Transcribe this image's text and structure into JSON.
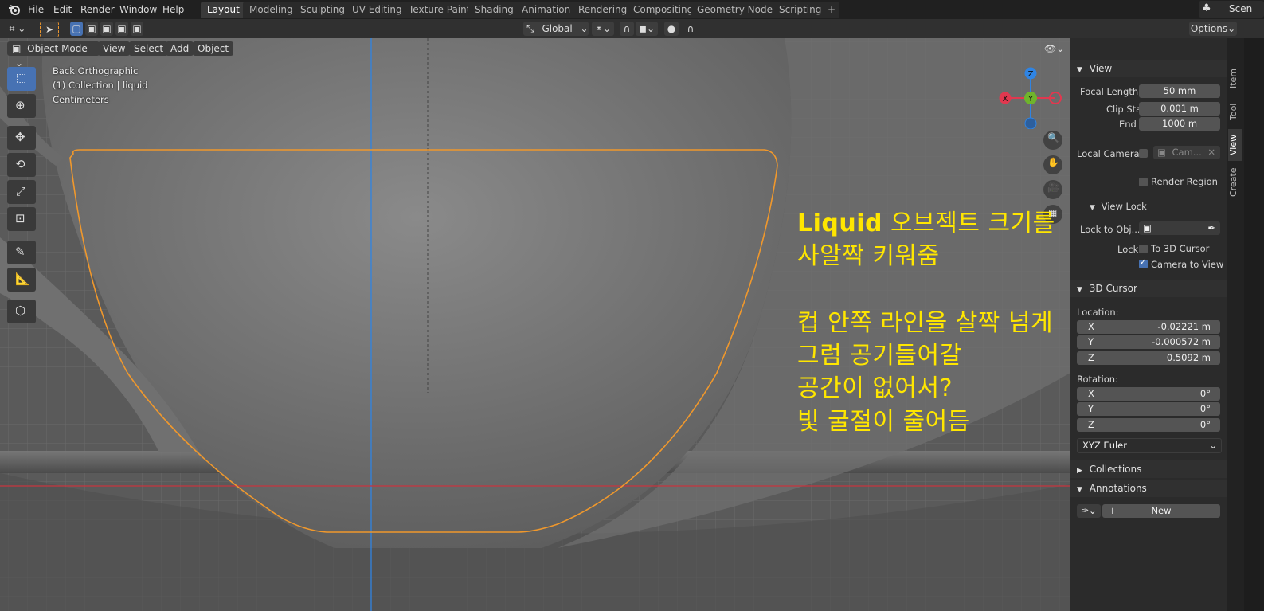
{
  "topbar": {
    "menus": [
      "File",
      "Edit",
      "Render",
      "Window",
      "Help"
    ],
    "workspaces": [
      "Layout",
      "Modeling",
      "Sculpting",
      "UV Editing",
      "Texture Paint",
      "Shading",
      "Animation",
      "Rendering",
      "Compositing",
      "Geometry Nodes",
      "Scripting"
    ],
    "active_workspace": "Layout",
    "add_tab": "+",
    "scene_label": "Scen"
  },
  "toolheader": {
    "orientation": "Global",
    "options": "Options"
  },
  "viewport_header": {
    "mode": "Object Mode",
    "menus": [
      "View",
      "Select",
      "Add",
      "Object"
    ]
  },
  "viewport_info": {
    "view": "Back Orthographic",
    "collection": "(1) Collection | liquid",
    "units": "Centimeters"
  },
  "gizmo": {
    "z": "Z",
    "y": "Y",
    "x": "X"
  },
  "annotation_note": {
    "line1_bold": "Liquid",
    "line1_rest": " 오브젝트 크기를",
    "line2": "사알짝 키워줌",
    "line3": "컵 안쪽 라인을 살짝 넘게",
    "line4": "그럼 공기들어갈",
    "line5": "공간이 없어서?",
    "line6": "빛 굴절이 줄어듬"
  },
  "sidebar": {
    "view_panel": {
      "title": "View",
      "focal_length_label": "Focal Length",
      "focal_length": "50 mm",
      "clip_start_label": "Clip Start",
      "clip_start": "0.001 m",
      "end_label": "End",
      "end": "1000 m",
      "local_camera_label": "Local Camera",
      "local_camera_value": "Cam...",
      "render_region_label": "Render Region"
    },
    "view_lock": {
      "title": "View Lock",
      "lock_to_obj_label": "Lock to Obj...",
      "lock_label": "Lock",
      "to_3d_cursor": "To 3D Cursor",
      "camera_to_view": "Camera to View"
    },
    "cursor_panel": {
      "title": "3D Cursor",
      "location_label": "Location:",
      "loc_x": "-0.02221 m",
      "loc_y": "-0.000572 m",
      "loc_z": "0.5092 m",
      "rotation_label": "Rotation:",
      "rot_x": "0°",
      "rot_y": "0°",
      "rot_z": "0°",
      "x_label": "X",
      "y_label": "Y",
      "z_label": "Z",
      "rotation_mode": "XYZ Euler"
    },
    "collections_title": "Collections",
    "annotations_title": "Annotations",
    "new_button": "New"
  },
  "tabs": [
    "Item",
    "Tool",
    "View",
    "Create"
  ],
  "colors": {
    "accent": "#4772b3",
    "selection_outline": "#f0982c",
    "note_yellow": "#ffe600",
    "axis_red": "#e0384f",
    "axis_green": "#6fb42c",
    "axis_blue": "#2f84e3"
  }
}
